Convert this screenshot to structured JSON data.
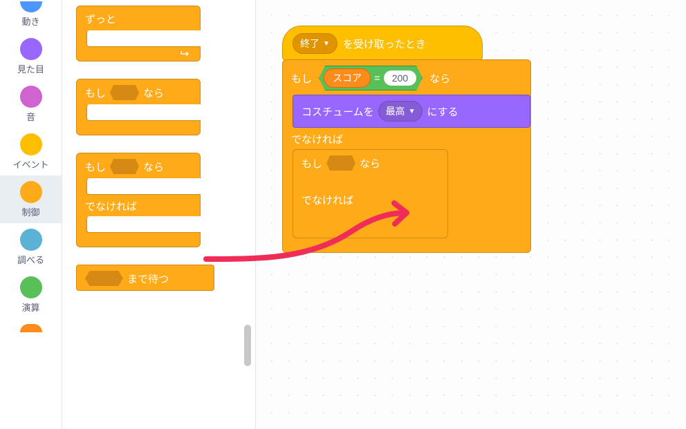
{
  "categories": [
    {
      "id": "motion",
      "label": "動き",
      "color": "#4c97ff"
    },
    {
      "id": "looks",
      "label": "見た目",
      "color": "#9966ff"
    },
    {
      "id": "sound",
      "label": "音",
      "color": "#cf63cf"
    },
    {
      "id": "events",
      "label": "イベント",
      "color": "#ffbf00"
    },
    {
      "id": "control",
      "label": "制御",
      "color": "#ffab19"
    },
    {
      "id": "sensing",
      "label": "調べる",
      "color": "#5cb1d6"
    },
    {
      "id": "operators",
      "label": "演算",
      "color": "#59c059"
    }
  ],
  "selected_category_index": 4,
  "palette": {
    "forever": {
      "label": "ずっと"
    },
    "if": {
      "label_if": "もし",
      "label_then": "なら"
    },
    "if_else": {
      "label_if": "もし",
      "label_then": "なら",
      "label_else": "でなければ"
    },
    "wait_until": {
      "label_suffix": "まで待つ"
    }
  },
  "script": {
    "hat": {
      "message_field": "終了",
      "suffix": "を受け取ったとき"
    },
    "outer_if": {
      "label_if": "もし",
      "label_then": "なら",
      "label_else": "でなければ"
    },
    "condition": {
      "variable": "スコア",
      "op": "=",
      "value": "200"
    },
    "looks": {
      "prefix": "コスチュームを",
      "dropdown": "最高",
      "suffix": "にする"
    },
    "inner_if": {
      "label_if": "もし",
      "label_then": "なら",
      "label_else": "でなければ"
    }
  },
  "colors": {
    "control": "#ffab19",
    "control_border": "#cf8b17",
    "events": "#ffbf00",
    "looks": "#9966ff",
    "operators": "#59c059",
    "variables": "#ff8c1a"
  }
}
